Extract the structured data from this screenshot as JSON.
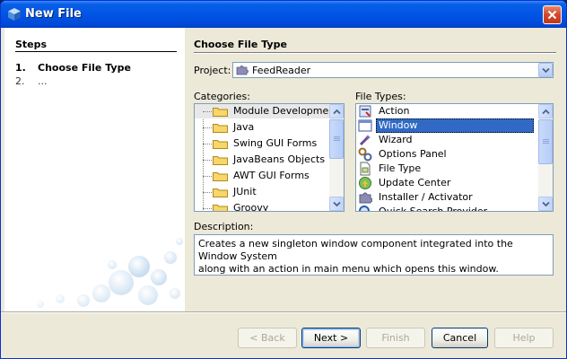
{
  "window": {
    "title": "New File"
  },
  "steps": {
    "heading": "Steps",
    "items": [
      {
        "number": "1.",
        "label": "Choose File Type"
      },
      {
        "number": "2.",
        "label": "..."
      }
    ]
  },
  "main": {
    "heading": "Choose File Type",
    "project_label": "Project:",
    "project_value": "FeedReader",
    "categories_label": "Categories:",
    "categories": [
      "Module Development",
      "Java",
      "Swing GUI Forms",
      "JavaBeans Objects",
      "AWT GUI Forms",
      "JUnit",
      "Groovy"
    ],
    "selected_category": "Module Development",
    "file_types_label": "File Types:",
    "file_types": [
      {
        "label": "Action",
        "icon": "action-icon"
      },
      {
        "label": "Window",
        "icon": "window-icon"
      },
      {
        "label": "Wizard",
        "icon": "wizard-icon"
      },
      {
        "label": "Options Panel",
        "icon": "options-panel-icon"
      },
      {
        "label": "File Type",
        "icon": "file-type-icon"
      },
      {
        "label": "Update Center",
        "icon": "update-center-icon"
      },
      {
        "label": "Installer / Activator",
        "icon": "installer-icon"
      },
      {
        "label": "Quick Search Provider",
        "icon": "quick-search-icon"
      }
    ],
    "selected_file_type": "Window",
    "description_label": "Description:",
    "description_line1": "Creates a new singleton window component integrated into the Window System",
    "description_line2": "along with an action in main menu which opens this window."
  },
  "buttons": {
    "back": "< Back",
    "next": "Next >",
    "finish": "Finish",
    "cancel": "Cancel",
    "help": "Help"
  },
  "colors": {
    "titlebar": "#0055e5",
    "selection": "#316ac5",
    "background": "#ece9d8"
  }
}
